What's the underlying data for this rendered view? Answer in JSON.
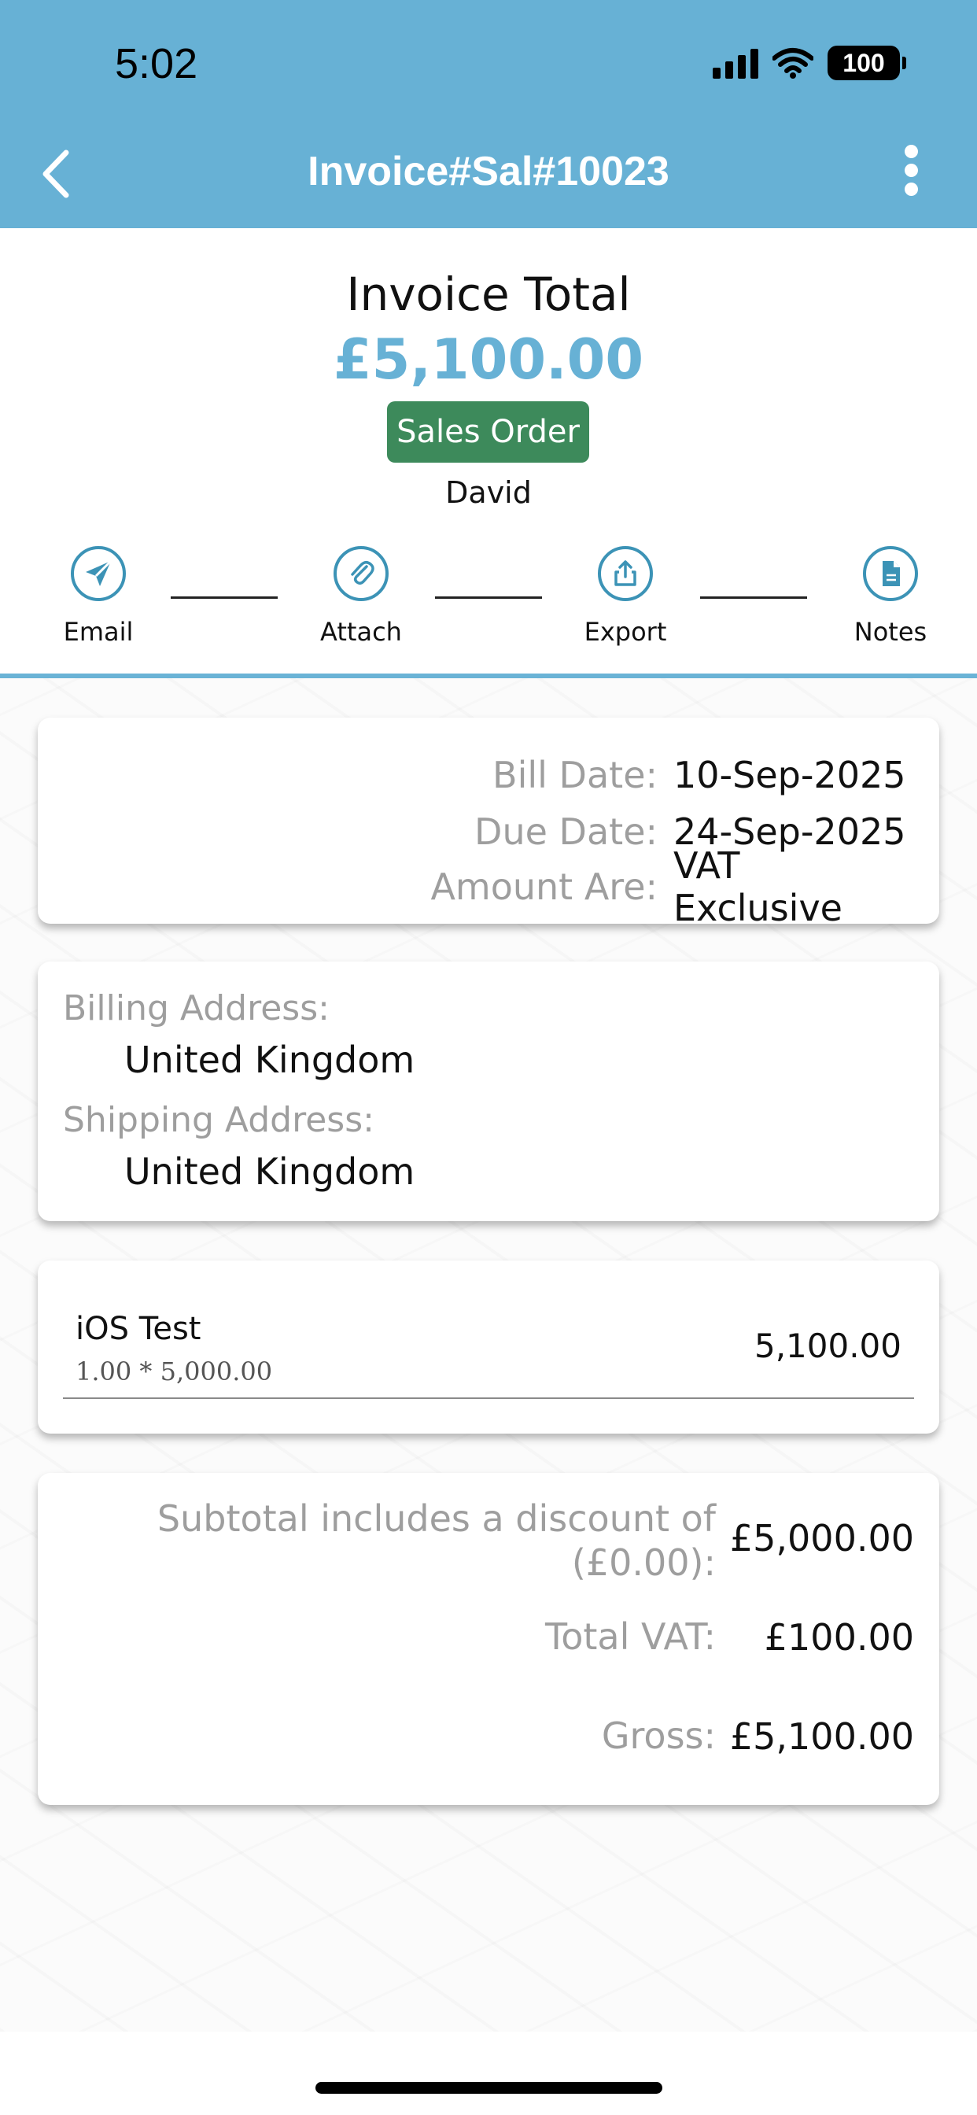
{
  "status_bar": {
    "time": "5:02",
    "battery": "100"
  },
  "header": {
    "title": "Invoice#Sal#10023"
  },
  "summary": {
    "total_label": "Invoice Total",
    "total_amount": "£5,100.00",
    "badge": "Sales Order",
    "customer": "David"
  },
  "actions": [
    {
      "label": "Email",
      "icon": "send-icon"
    },
    {
      "label": "Attach",
      "icon": "paperclip-icon"
    },
    {
      "label": "Export",
      "icon": "share-icon"
    },
    {
      "label": "Notes",
      "icon": "document-icon"
    }
  ],
  "dates": {
    "bill_label": "Bill Date:",
    "bill_value": "10-Sep-2025",
    "due_label": "Due Date:",
    "due_value": "24-Sep-2025",
    "amount_label": "Amount Are:",
    "amount_value": "VAT Exclusive"
  },
  "address": {
    "billing_label": "Billing Address:",
    "billing_value": "United Kingdom",
    "shipping_label": "Shipping Address:",
    "shipping_value": "United Kingdom"
  },
  "items": [
    {
      "name": "iOS Test",
      "detail": "1.00 * 5,000.00",
      "amount": "5,100.00"
    }
  ],
  "totals": {
    "subtotal_label_1": "Subtotal includes a discount of",
    "subtotal_label_2": "(£0.00):",
    "subtotal_value": "£5,000.00",
    "vat_label": "Total VAT:",
    "vat_value": "£100.00",
    "gross_label": "Gross:",
    "gross_value": "£5,100.00"
  },
  "colors": {
    "header": "#67b1d5",
    "accent": "#67b1d5",
    "badge": "#3d8a5b",
    "icon": "#3c93b6"
  }
}
